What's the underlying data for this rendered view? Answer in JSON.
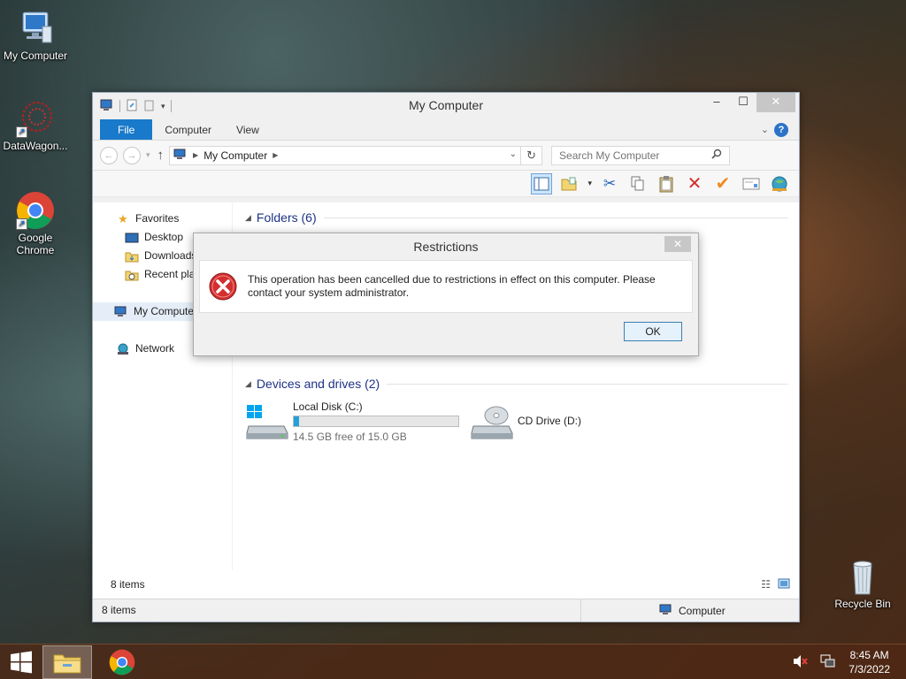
{
  "desktop": {
    "icons": [
      {
        "label": "My Computer"
      },
      {
        "label": "DataWagon..."
      },
      {
        "label": "Google Chrome"
      },
      {
        "label": "Recycle Bin"
      }
    ]
  },
  "window": {
    "title": "My Computer",
    "tabs": [
      "File",
      "Computer",
      "View"
    ],
    "address": {
      "crumb": "My Computer"
    },
    "search": {
      "placeholder": "Search My Computer"
    },
    "nav": {
      "favorites": "Favorites",
      "desktop": "Desktop",
      "downloads": "Downloads",
      "recent": "Recent places",
      "my_computer": "My Computer",
      "network": "Network"
    },
    "groups": {
      "folders": "Folders (6)",
      "devices": "Devices and drives (2)"
    },
    "drives": [
      {
        "name": "Local Disk (C:)",
        "free_text": "14.5 GB free of 15.0 GB",
        "used_fraction": 0.03
      },
      {
        "name": "CD Drive (D:)"
      }
    ],
    "items_count": "8 items",
    "status_count": "8 items",
    "status_location": "Computer"
  },
  "dialog": {
    "title": "Restrictions",
    "message": "This operation has been cancelled due to restrictions in effect on this computer. Please contact your system administrator.",
    "ok_label": "OK"
  },
  "taskbar": {
    "time": "8:45 AM",
    "date": "7/3/2022"
  },
  "colors": {
    "accent": "#1979ca",
    "error": "#d32f2f",
    "progress": "#26a0da"
  }
}
